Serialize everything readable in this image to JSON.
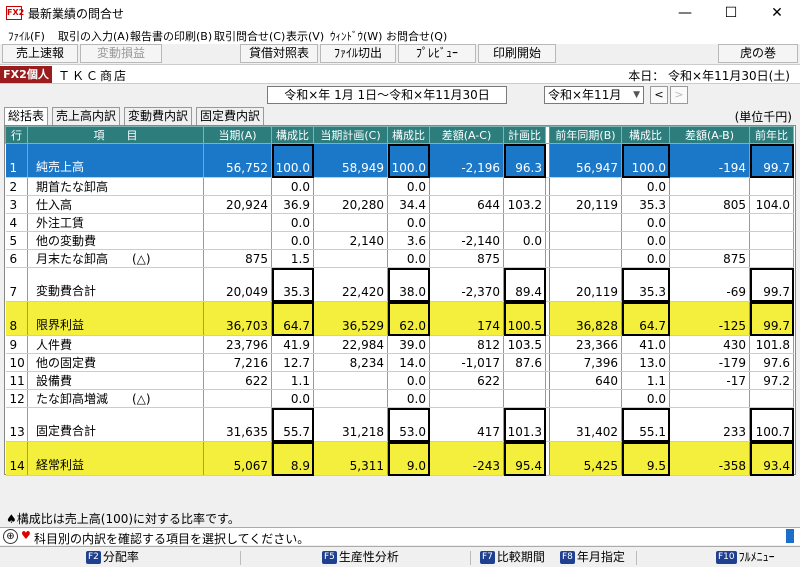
{
  "window": {
    "title": "最新業績の問合せ",
    "app_icon_text": "FX2",
    "minimize": "—",
    "maximize": "☐",
    "close": "✕"
  },
  "menu": [
    "ﾌｧｲﾙ(F)",
    "取引の入力(A)",
    "報告書の印刷(B)",
    "取引問合せ(C)",
    "表示(V)",
    "ｳｨﾝﾄﾞｳ(W)",
    "お問合せ(Q)"
  ],
  "toolbar": {
    "sales_report": "売上速報",
    "variable_decrease": "変動損益",
    "balance_sheet": "貸借対照表",
    "file_switch": "ﾌｧｲﾙ切出",
    "preview": "ﾌﾟﾚﾋﾞｭｰ",
    "print_start": "印刷開始",
    "tora_no_maki": "虎の巻"
  },
  "company": {
    "badge": "FX2個人",
    "name": "ＴＫＣ商店",
    "today": "本日： 令和×年11月30日(土)"
  },
  "period": {
    "range": "令和×年 1月 1日～令和×年11月30日",
    "month": "令和×年11月",
    "prev": "<",
    "next": ">"
  },
  "tabs": [
    "総括表",
    "売上高内訳",
    "変動費内訳",
    "固定費内訳"
  ],
  "unit": "(単位千円)",
  "table": {
    "headers": [
      "行",
      "項　　目",
      "当期(A)",
      "構成比",
      "当期計画(C)",
      "構成比",
      "差額(A-C)",
      "計画比",
      "前年同期(B)",
      "構成比",
      "差額(A-B)",
      "前年比"
    ],
    "rows": [
      {
        "no": "1",
        "item": "純売上高",
        "a": "56,752",
        "ra": "100.0",
        "c": "58,949",
        "rc": "100.0",
        "ac": "-2,196",
        "pc": "96.3",
        "b": "56,947",
        "rb": "100.0",
        "ab": "-194",
        "py": "99.7"
      },
      {
        "no": "2",
        "item": "期首たな卸高",
        "a": "",
        "ra": "0.0",
        "c": "",
        "rc": "0.0",
        "ac": "",
        "pc": "",
        "b": "",
        "rb": "0.0",
        "ab": "",
        "py": ""
      },
      {
        "no": "3",
        "item": "仕入高",
        "a": "20,924",
        "ra": "36.9",
        "c": "20,280",
        "rc": "34.4",
        "ac": "644",
        "pc": "103.2",
        "b": "20,119",
        "rb": "35.3",
        "ab": "805",
        "py": "104.0"
      },
      {
        "no": "4",
        "item": "外注工賃",
        "a": "",
        "ra": "0.0",
        "c": "",
        "rc": "0.0",
        "ac": "",
        "pc": "",
        "b": "",
        "rb": "0.0",
        "ab": "",
        "py": ""
      },
      {
        "no": "5",
        "item": "他の変動費",
        "a": "",
        "ra": "0.0",
        "c": "2,140",
        "rc": "3.6",
        "ac": "-2,140",
        "pc": "0.0",
        "b": "",
        "rb": "0.0",
        "ab": "",
        "py": ""
      },
      {
        "no": "6",
        "item": "月末たな卸高　　(△)",
        "a": "875",
        "ra": "1.5",
        "c": "",
        "rc": "0.0",
        "ac": "875",
        "pc": "",
        "b": "",
        "rb": "0.0",
        "ab": "875",
        "py": ""
      },
      {
        "no": "7",
        "item": "変動費合計",
        "a": "20,049",
        "ra": "35.3",
        "c": "22,420",
        "rc": "38.0",
        "ac": "-2,370",
        "pc": "89.4",
        "b": "20,119",
        "rb": "35.3",
        "ab": "-69",
        "py": "99.7"
      },
      {
        "no": "8",
        "item": "限界利益",
        "a": "36,703",
        "ra": "64.7",
        "c": "36,529",
        "rc": "62.0",
        "ac": "174",
        "pc": "100.5",
        "b": "36,828",
        "rb": "64.7",
        "ab": "-125",
        "py": "99.7"
      },
      {
        "no": "9",
        "item": "人件費",
        "a": "23,796",
        "ra": "41.9",
        "c": "22,984",
        "rc": "39.0",
        "ac": "812",
        "pc": "103.5",
        "b": "23,366",
        "rb": "41.0",
        "ab": "430",
        "py": "101.8"
      },
      {
        "no": "10",
        "item": "他の固定費",
        "a": "7,216",
        "ra": "12.7",
        "c": "8,234",
        "rc": "14.0",
        "ac": "-1,017",
        "pc": "87.6",
        "b": "7,396",
        "rb": "13.0",
        "ab": "-179",
        "py": "97.6"
      },
      {
        "no": "11",
        "item": "設備費",
        "a": "622",
        "ra": "1.1",
        "c": "",
        "rc": "0.0",
        "ac": "622",
        "pc": "",
        "b": "640",
        "rb": "1.1",
        "ab": "-17",
        "py": "97.2"
      },
      {
        "no": "12",
        "item": "たな卸高増減　　(△)",
        "a": "",
        "ra": "0.0",
        "c": "",
        "rc": "0.0",
        "ac": "",
        "pc": "",
        "b": "",
        "rb": "0.0",
        "ab": "",
        "py": ""
      },
      {
        "no": "13",
        "item": "固定費合計",
        "a": "31,635",
        "ra": "55.7",
        "c": "31,218",
        "rc": "53.0",
        "ac": "417",
        "pc": "101.3",
        "b": "31,402",
        "rb": "55.1",
        "ab": "233",
        "py": "100.7"
      },
      {
        "no": "14",
        "item": "経常利益",
        "a": "5,067",
        "ra": "8.9",
        "c": "5,311",
        "rc": "9.0",
        "ac": "-243",
        "pc": "95.4",
        "b": "5,425",
        "rb": "9.5",
        "ab": "-358",
        "py": "93.4"
      }
    ]
  },
  "note": "♠構成比は売上高(100)に対する比率です。",
  "status": {
    "icon": "⊕",
    "heart": "♥",
    "text": "科目別の内訳を確認する項目を選択してください。"
  },
  "fkeys": [
    {
      "key": "F2",
      "label": "分配率"
    },
    {
      "key": "F5",
      "label": "生産性分析"
    },
    {
      "key": "F7",
      "label": "比較期間"
    },
    {
      "key": "F8",
      "label": "年月指定"
    },
    {
      "key": "F10",
      "label": "ﾌﾙﾒﾆｭｰ"
    }
  ],
  "colors": {
    "header_bg": "#2e7d7d",
    "selected_row": "#1b78c8",
    "highlight_row": "#f3ef3c",
    "badge": "#9b1c1c"
  }
}
